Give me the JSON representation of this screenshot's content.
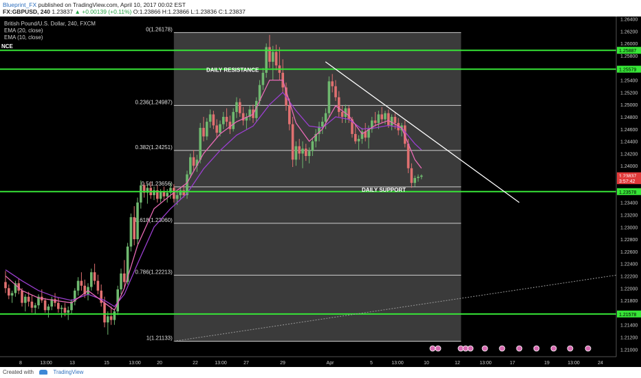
{
  "header": {
    "line1": {
      "publisher": "Blueprint_FX",
      "published_text": "published on TradingView.com, April 10, 2017 00:02 EST"
    },
    "line2": {
      "symbol": "FX:GBPUSD, 240",
      "last": "1.23837",
      "change": "▲ +0.00139 (+0.11%)",
      "ohlc": "O:1.23866 H:1.23866 L:1.23836 C:1.23837"
    }
  },
  "legend": {
    "instrument": "British Pound/U.S. Dollar, 240, FXCM",
    "ema1": "EMA (20, close)",
    "ema2": "EMA (10, close)"
  },
  "footer": {
    "created_with": "Created with",
    "brand": "TradingView"
  },
  "colors": {
    "background": "#000000",
    "shaded_region": "#3b3b3b",
    "candle_up": "#6fb86f",
    "candle_down": "#e07070",
    "ema20": "#9b3fd0",
    "ema10": "#e86ab5",
    "fib_lines": "#d0d0d0",
    "sr_lines": "#37e637",
    "trend_line": "#ffffff"
  },
  "chart_data": {
    "type": "candlestick",
    "symbol": "GBPUSD",
    "timeframe": "240",
    "y_axis": {
      "range": [
        1.2088,
        1.2644
      ],
      "ticks": [
        "1.26400",
        "1.26200",
        "1.26000",
        "1.25800",
        "1.25600",
        "1.25400",
        "1.25200",
        "1.25000",
        "1.24800",
        "1.24600",
        "1.24400",
        "1.24200",
        "1.24000",
        "1.23800",
        "1.23600",
        "1.23400",
        "1.23200",
        "1.23000",
        "1.22800",
        "1.22600",
        "1.22400",
        "1.22200",
        "1.22000",
        "1.21800",
        "1.21600",
        "1.21400",
        "1.21200",
        "1.21000"
      ]
    },
    "x_axis": {
      "labels": [
        "8",
        "13:00",
        "13",
        "15",
        "13:00",
        "20",
        "22",
        "13:00",
        "27",
        "29",
        "Apr",
        "5",
        "13:00",
        "10",
        "12",
        "13:00",
        "17",
        "19",
        "13:00",
        "24"
      ]
    },
    "price_labels": [
      {
        "value": 1.25887,
        "text": "1.25887",
        "style": "green"
      },
      {
        "value": 1.25579,
        "text": "1.25579",
        "style": "green"
      },
      {
        "value": 1.23837,
        "text": "1.23837",
        "style": "red"
      },
      {
        "value": 1.23757,
        "text": "3:57:42",
        "style": "red"
      },
      {
        "value": 1.23578,
        "text": "1.23578",
        "style": "green"
      },
      {
        "value": 1.21578,
        "text": "1.21578",
        "style": "green"
      }
    ],
    "fibonacci": [
      {
        "level": "0",
        "value": 1.26178,
        "label": "0(1.26178)"
      },
      {
        "level": "0.236",
        "value": 1.24987,
        "label": "0.236(1.24987)"
      },
      {
        "level": "0.382",
        "value": 1.24251,
        "label": "0.382(1.24251)"
      },
      {
        "level": "0.5",
        "value": 1.23656,
        "label": "0.5(1.23656)"
      },
      {
        "level": "0.618",
        "value": 1.2306,
        "label": "0.618(1.23060)"
      },
      {
        "level": "0.786",
        "value": 1.22213,
        "label": "0.786(1.22213)"
      },
      {
        "level": "1",
        "value": 1.21133,
        "label": "1(1.21133)"
      }
    ],
    "sr_levels": [
      {
        "value": 1.25887,
        "label": "NCE"
      },
      {
        "value": 1.25579,
        "label": "DAILY RESISTANCE"
      },
      {
        "value": 1.23578,
        "label": "DAILY SUPPORT"
      },
      {
        "value": 1.21578,
        "label": ""
      }
    ],
    "trend_line": {
      "from": [
        84,
        1.257
      ],
      "to": [
        174,
        1.234
      ]
    },
    "dotted_line": {
      "from": [
        51,
        1.21133
      ],
      "to": [
        216,
        1.22213
      ]
    },
    "shaded_region": {
      "from_bar": 51,
      "to_bar": 138,
      "top": 1.26178,
      "bottom": 1.21133
    },
    "candles": [
      [
        0,
        1.221,
        1.2228,
        1.2192,
        1.22
      ],
      [
        1,
        1.22,
        1.2206,
        1.2182,
        1.2188
      ],
      [
        2,
        1.2188,
        1.2196,
        1.2176,
        1.2192
      ],
      [
        3,
        1.2192,
        1.2212,
        1.2186,
        1.2208
      ],
      [
        4,
        1.2208,
        1.2216,
        1.219,
        1.2196
      ],
      [
        5,
        1.2196,
        1.22,
        1.217,
        1.2176
      ],
      [
        6,
        1.2176,
        1.219,
        1.2162,
        1.2186
      ],
      [
        7,
        1.2186,
        1.2194,
        1.217,
        1.2178
      ],
      [
        8,
        1.2178,
        1.2188,
        1.216,
        1.2168
      ],
      [
        9,
        1.2168,
        1.2176,
        1.2158,
        1.2172
      ],
      [
        10,
        1.2172,
        1.219,
        1.2166,
        1.2186
      ],
      [
        11,
        1.2186,
        1.2198,
        1.2176,
        1.218
      ],
      [
        12,
        1.218,
        1.2184,
        1.216,
        1.2164
      ],
      [
        13,
        1.2164,
        1.2174,
        1.2152,
        1.217
      ],
      [
        14,
        1.217,
        1.2186,
        1.2164,
        1.2182
      ],
      [
        15,
        1.2182,
        1.2192,
        1.217,
        1.2176
      ],
      [
        16,
        1.2176,
        1.2184,
        1.216,
        1.2166
      ],
      [
        17,
        1.2166,
        1.2172,
        1.2152,
        1.2168
      ],
      [
        18,
        1.2168,
        1.2176,
        1.2154,
        1.216
      ],
      [
        19,
        1.216,
        1.217,
        1.2148,
        1.2164
      ],
      [
        20,
        1.2164,
        1.2182,
        1.2158,
        1.2178
      ],
      [
        21,
        1.2178,
        1.22,
        1.2172,
        1.2196
      ],
      [
        22,
        1.2196,
        1.2218,
        1.2188,
        1.2212
      ],
      [
        23,
        1.2212,
        1.2226,
        1.2196,
        1.2204
      ],
      [
        24,
        1.2204,
        1.2214,
        1.2184,
        1.219
      ],
      [
        25,
        1.219,
        1.2208,
        1.218,
        1.2202
      ],
      [
        26,
        1.2202,
        1.2232,
        1.2196,
        1.2226
      ],
      [
        27,
        1.2226,
        1.224,
        1.2206,
        1.2212
      ],
      [
        28,
        1.2212,
        1.2222,
        1.219,
        1.2196
      ],
      [
        29,
        1.2196,
        1.2206,
        1.217,
        1.2176
      ],
      [
        30,
        1.2176,
        1.2186,
        1.2136,
        1.2144
      ],
      [
        31,
        1.2144,
        1.2162,
        1.2124,
        1.2154
      ],
      [
        32,
        1.2154,
        1.217,
        1.214,
        1.2148
      ],
      [
        33,
        1.2148,
        1.2166,
        1.214,
        1.2162
      ],
      [
        34,
        1.2162,
        1.2204,
        1.2156,
        1.2198
      ],
      [
        35,
        1.2198,
        1.2232,
        1.219,
        1.2224
      ],
      [
        36,
        1.2224,
        1.2246,
        1.22,
        1.221
      ],
      [
        37,
        1.221,
        1.2274,
        1.2206,
        1.2268
      ],
      [
        38,
        1.2268,
        1.2322,
        1.226,
        1.2316
      ],
      [
        39,
        1.2316,
        1.2334,
        1.227,
        1.228
      ],
      [
        40,
        1.228,
        1.2348,
        1.2272,
        1.234
      ],
      [
        41,
        1.234,
        1.2376,
        1.233,
        1.2368
      ],
      [
        42,
        1.2368,
        1.2372,
        1.2348,
        1.2356
      ],
      [
        43,
        1.2356,
        1.237,
        1.2338,
        1.2364
      ],
      [
        44,
        1.2364,
        1.2374,
        1.2346,
        1.2352
      ],
      [
        45,
        1.2352,
        1.2366,
        1.2344,
        1.236
      ],
      [
        46,
        1.236,
        1.2368,
        1.234,
        1.2346
      ],
      [
        47,
        1.2346,
        1.2362,
        1.234,
        1.2358
      ],
      [
        48,
        1.2358,
        1.2366,
        1.2344,
        1.235
      ],
      [
        49,
        1.235,
        1.2362,
        1.234,
        1.2356
      ],
      [
        50,
        1.2356,
        1.2372,
        1.2346,
        1.2364
      ],
      [
        51,
        1.2364,
        1.237,
        1.234,
        1.2346
      ],
      [
        52,
        1.2346,
        1.2358,
        1.2336,
        1.2352
      ],
      [
        53,
        1.2352,
        1.2366,
        1.2344,
        1.236
      ],
      [
        54,
        1.236,
        1.2368,
        1.2348,
        1.2352
      ],
      [
        55,
        1.2352,
        1.2392,
        1.2346,
        1.2386
      ],
      [
        56,
        1.2386,
        1.242,
        1.238,
        1.2414
      ],
      [
        57,
        1.2414,
        1.2426,
        1.2392,
        1.24
      ],
      [
        58,
        1.24,
        1.2418,
        1.239,
        1.241
      ],
      [
        59,
        1.241,
        1.247,
        1.2404,
        1.2462
      ],
      [
        60,
        1.2462,
        1.248,
        1.244,
        1.2448
      ],
      [
        61,
        1.2448,
        1.2478,
        1.2442,
        1.2472
      ],
      [
        62,
        1.2472,
        1.2492,
        1.2462,
        1.2484
      ],
      [
        63,
        1.2484,
        1.249,
        1.246,
        1.2466
      ],
      [
        64,
        1.2466,
        1.2476,
        1.2446,
        1.2454
      ],
      [
        65,
        1.2454,
        1.2474,
        1.2448,
        1.2468
      ],
      [
        66,
        1.2468,
        1.2488,
        1.246,
        1.248
      ],
      [
        67,
        1.248,
        1.2494,
        1.2464,
        1.2472
      ],
      [
        68,
        1.2472,
        1.2482,
        1.2452,
        1.246
      ],
      [
        69,
        1.246,
        1.2494,
        1.2456,
        1.2488
      ],
      [
        70,
        1.2488,
        1.2512,
        1.2478,
        1.2504
      ],
      [
        71,
        1.2504,
        1.251,
        1.248,
        1.2486
      ],
      [
        72,
        1.2486,
        1.2496,
        1.2466,
        1.2474
      ],
      [
        73,
        1.2474,
        1.2486,
        1.246,
        1.248
      ],
      [
        74,
        1.248,
        1.2498,
        1.2474,
        1.2492
      ],
      [
        75,
        1.2492,
        1.25,
        1.247,
        1.2478
      ],
      [
        76,
        1.2478,
        1.2512,
        1.2472,
        1.2506
      ],
      [
        77,
        1.2506,
        1.254,
        1.2498,
        1.2532
      ],
      [
        78,
        1.2532,
        1.256,
        1.2524,
        1.2552
      ],
      [
        79,
        1.2552,
        1.26,
        1.2544,
        1.2594
      ],
      [
        80,
        1.2594,
        1.2614,
        1.256,
        1.257
      ],
      [
        81,
        1.257,
        1.2596,
        1.254,
        1.2586
      ],
      [
        82,
        1.2586,
        1.2598,
        1.2556,
        1.2564
      ],
      [
        83,
        1.2564,
        1.2594,
        1.254,
        1.2552
      ],
      [
        84,
        1.2552,
        1.2574,
        1.252,
        1.2528
      ],
      [
        85,
        1.2528,
        1.2536,
        1.249,
        1.2498
      ],
      [
        86,
        1.2498,
        1.251,
        1.2458,
        1.2468
      ],
      [
        87,
        1.2468,
        1.248,
        1.2398,
        1.241
      ],
      [
        88,
        1.241,
        1.244,
        1.24,
        1.2432
      ],
      [
        89,
        1.2432,
        1.2444,
        1.241,
        1.242
      ],
      [
        90,
        1.242,
        1.244,
        1.2396,
        1.2428
      ],
      [
        91,
        1.2428,
        1.2436,
        1.2408,
        1.2416
      ],
      [
        92,
        1.2416,
        1.243,
        1.2404,
        1.2424
      ],
      [
        93,
        1.2424,
        1.2446,
        1.2416,
        1.244
      ],
      [
        94,
        1.244,
        1.246,
        1.243,
        1.2452
      ],
      [
        95,
        1.2452,
        1.2472,
        1.244,
        1.2464
      ],
      [
        96,
        1.2464,
        1.248,
        1.2452,
        1.2472
      ],
      [
        97,
        1.2472,
        1.2494,
        1.246,
        1.2486
      ],
      [
        98,
        1.2486,
        1.2546,
        1.248,
        1.2538
      ],
      [
        99,
        1.2538,
        1.255,
        1.252,
        1.253
      ],
      [
        100,
        1.253,
        1.254,
        1.2506,
        1.2512
      ],
      [
        101,
        1.2512,
        1.2522,
        1.248,
        1.2488
      ],
      [
        102,
        1.2488,
        1.2498,
        1.247,
        1.248
      ],
      [
        103,
        1.248,
        1.25,
        1.247,
        1.2494
      ],
      [
        104,
        1.2494,
        1.2498,
        1.247,
        1.2476
      ],
      [
        105,
        1.2476,
        1.248,
        1.2446,
        1.2452
      ],
      [
        106,
        1.2452,
        1.2468,
        1.2436,
        1.244
      ],
      [
        107,
        1.244,
        1.245,
        1.2426,
        1.2444
      ],
      [
        108,
        1.2444,
        1.2462,
        1.2436,
        1.2456
      ],
      [
        109,
        1.2456,
        1.247,
        1.244,
        1.2446
      ],
      [
        110,
        1.2446,
        1.2466,
        1.2428,
        1.246
      ],
      [
        111,
        1.246,
        1.248,
        1.2454,
        1.2474
      ],
      [
        112,
        1.2474,
        1.2488,
        1.2464,
        1.247
      ],
      [
        113,
        1.247,
        1.249,
        1.246,
        1.2484
      ],
      [
        114,
        1.2484,
        1.2496,
        1.247,
        1.2476
      ],
      [
        115,
        1.2476,
        1.249,
        1.2468,
        1.2486
      ],
      [
        116,
        1.2486,
        1.2492,
        1.2462,
        1.2466
      ],
      [
        117,
        1.2466,
        1.2484,
        1.2458,
        1.248
      ],
      [
        118,
        1.248,
        1.2486,
        1.246,
        1.247
      ],
      [
        119,
        1.247,
        1.2478,
        1.245,
        1.2458
      ],
      [
        120,
        1.2458,
        1.247,
        1.2448,
        1.2466
      ],
      [
        121,
        1.2466,
        1.2474,
        1.243,
        1.2436
      ],
      [
        122,
        1.2436,
        1.2444,
        1.2388,
        1.2396
      ],
      [
        123,
        1.2396,
        1.2404,
        1.2364,
        1.2372
      ],
      [
        124,
        1.2372,
        1.2384,
        1.2366,
        1.238
      ],
      [
        125,
        1.238,
        1.2386,
        1.2374,
        1.2382
      ],
      [
        126,
        1.2382,
        1.2386,
        1.2378,
        1.2384
      ]
    ],
    "ema20": [
      [
        0,
        1.223
      ],
      [
        5,
        1.2212
      ],
      [
        10,
        1.2196
      ],
      [
        15,
        1.2186
      ],
      [
        20,
        1.218
      ],
      [
        25,
        1.219
      ],
      [
        30,
        1.218
      ],
      [
        33,
        1.217
      ],
      [
        36,
        1.219
      ],
      [
        40,
        1.224
      ],
      [
        45,
        1.23
      ],
      [
        50,
        1.233
      ],
      [
        55,
        1.2355
      ],
      [
        60,
        1.2395
      ],
      [
        65,
        1.2425
      ],
      [
        70,
        1.245
      ],
      [
        75,
        1.2465
      ],
      [
        80,
        1.25
      ],
      [
        84,
        1.252
      ],
      [
        88,
        1.249
      ],
      [
        92,
        1.2465
      ],
      [
        96,
        1.2462
      ],
      [
        100,
        1.248
      ],
      [
        104,
        1.2476
      ],
      [
        108,
        1.246
      ],
      [
        112,
        1.2462
      ],
      [
        116,
        1.2466
      ],
      [
        120,
        1.2462
      ],
      [
        124,
        1.2436
      ],
      [
        126,
        1.2426
      ]
    ],
    "ema10": [
      [
        0,
        1.222
      ],
      [
        5,
        1.2196
      ],
      [
        10,
        1.2184
      ],
      [
        15,
        1.218
      ],
      [
        20,
        1.2176
      ],
      [
        25,
        1.2196
      ],
      [
        30,
        1.2176
      ],
      [
        33,
        1.2164
      ],
      [
        36,
        1.22
      ],
      [
        40,
        1.227
      ],
      [
        45,
        1.233
      ],
      [
        50,
        1.2352
      ],
      [
        55,
        1.2372
      ],
      [
        60,
        1.242
      ],
      [
        65,
        1.2452
      ],
      [
        70,
        1.2472
      ],
      [
        75,
        1.2484
      ],
      [
        80,
        1.254
      ],
      [
        84,
        1.254
      ],
      [
        88,
        1.247
      ],
      [
        92,
        1.244
      ],
      [
        96,
        1.246
      ],
      [
        100,
        1.2498
      ],
      [
        104,
        1.2482
      ],
      [
        108,
        1.2452
      ],
      [
        112,
        1.2466
      ],
      [
        116,
        1.2474
      ],
      [
        120,
        1.2462
      ],
      [
        124,
        1.241
      ],
      [
        126,
        1.2396
      ]
    ]
  }
}
